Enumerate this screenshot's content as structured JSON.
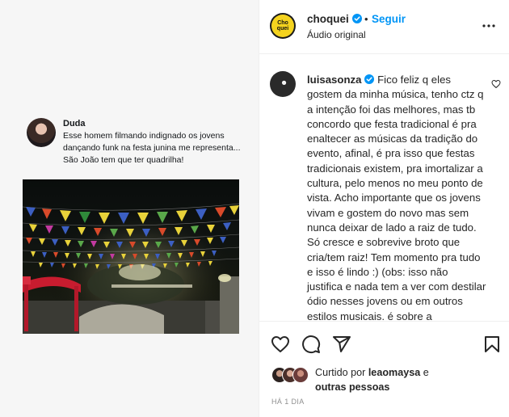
{
  "tweet": {
    "author": "Duda",
    "text": "Esse homem filmando indignado os jovens dançando funk na festa junina me representa... São João tem que ter quadrilha!"
  },
  "post": {
    "account": "choquei",
    "avatar_text": "Cho quei",
    "follow_label": "Seguir",
    "audio_label": "Áudio original",
    "separator": "•"
  },
  "comment": {
    "username": "luisasonza",
    "text": "Fico feliz q eles gostem da minha música, tenho ctz q a intenção foi das melhores, mas tb concordo que festa tradicional é pra enaltecer as músicas da tradição do evento, afinal, é pra isso que festas tradicionais existem, pra imortalizar a cultura, pelo menos no meu ponto de vista. Acho importante que os jovens vivam e gostem do novo mas sem nunca deixar de lado a raiz de tudo. Só cresce e sobrevive broto que cria/tem raiz! Tem momento pra tudo e isso é lindo :) (obs: isso não justifica e nada tem a ver com destilar ódio nesses jovens ou em outros estilos musicais, é sobre a"
  },
  "likes": {
    "prefix": "Curtido por",
    "user": "leaomaysa",
    "connector": "e",
    "others": "outras pessoas"
  },
  "timestamp": "HÁ 1 DIA",
  "colors": {
    "link": "#0095f6",
    "verified": "#0095f6",
    "muted": "#8e8e8e",
    "border": "#efefef"
  },
  "icons": [
    "verified-icon",
    "more-options-icon",
    "heart-icon",
    "comment-icon",
    "share-icon",
    "bookmark-icon"
  ]
}
